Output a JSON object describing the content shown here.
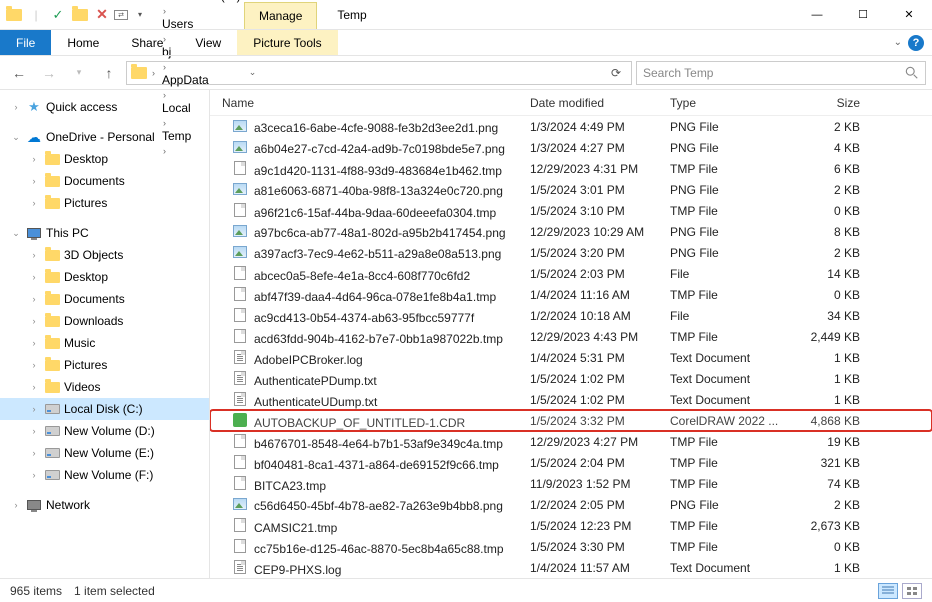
{
  "window": {
    "manage_tab": "Manage",
    "tools_tab": "Picture Tools",
    "title": "Temp",
    "min": "—",
    "max": "☐",
    "close": "✕"
  },
  "ribbon": {
    "file": "File",
    "home": "Home",
    "share": "Share",
    "view": "View"
  },
  "address": {
    "crumbs": [
      "Local Disk (C:)",
      "Users",
      "bj",
      "AppData",
      "Local",
      "Temp"
    ],
    "search_placeholder": "Search Temp"
  },
  "tree": {
    "quick": "Quick access",
    "onedrive": "OneDrive - Personal",
    "od_items": [
      "Desktop",
      "Documents",
      "Pictures"
    ],
    "thispc": "This PC",
    "pc_items": [
      "3D Objects",
      "Desktop",
      "Documents",
      "Downloads",
      "Music",
      "Pictures",
      "Videos",
      "Local Disk (C:)",
      "New Volume (D:)",
      "New Volume (E:)",
      "New Volume (F:)"
    ],
    "network": "Network"
  },
  "columns": {
    "name": "Name",
    "date": "Date modified",
    "type": "Type",
    "size": "Size"
  },
  "files": [
    {
      "name": "a3ceca16-6abe-4cfe-9088-fe3b2d3ee2d1.png",
      "date": "1/3/2024 4:49 PM",
      "type": "PNG File",
      "size": "2 KB",
      "icon": "png"
    },
    {
      "name": "a6b04e27-c7cd-42a4-ad9b-7c0198bde5e7.png",
      "date": "1/3/2024 4:27 PM",
      "type": "PNG File",
      "size": "4 KB",
      "icon": "png"
    },
    {
      "name": "a9c1d420-1131-4f88-93d9-483684e1b462.tmp",
      "date": "12/29/2023 4:31 PM",
      "type": "TMP File",
      "size": "6 KB",
      "icon": "doc"
    },
    {
      "name": "a81e6063-6871-40ba-98f8-13a324e0c720.png",
      "date": "1/5/2024 3:01 PM",
      "type": "PNG File",
      "size": "2 KB",
      "icon": "png"
    },
    {
      "name": "a96f21c6-15af-44ba-9daa-60deeefa0304.tmp",
      "date": "1/5/2024 3:10 PM",
      "type": "TMP File",
      "size": "0 KB",
      "icon": "doc"
    },
    {
      "name": "a97bc6ca-ab77-48a1-802d-a95b2b417454.png",
      "date": "12/29/2023 10:29 AM",
      "type": "PNG File",
      "size": "8 KB",
      "icon": "png"
    },
    {
      "name": "a397acf3-7ec9-4e62-b511-a29a8e08a513.png",
      "date": "1/5/2024 3:20 PM",
      "type": "PNG File",
      "size": "2 KB",
      "icon": "png"
    },
    {
      "name": "abcec0a5-8efe-4e1a-8cc4-608f770c6fd2",
      "date": "1/5/2024 2:03 PM",
      "type": "File",
      "size": "14 KB",
      "icon": "doc"
    },
    {
      "name": "abf47f39-daa4-4d64-96ca-078e1fe8b4a1.tmp",
      "date": "1/4/2024 11:16 AM",
      "type": "TMP File",
      "size": "0 KB",
      "icon": "doc"
    },
    {
      "name": "ac9cd413-0b54-4374-ab63-95fbcc59777f",
      "date": "1/2/2024 10:18 AM",
      "type": "File",
      "size": "34 KB",
      "icon": "doc"
    },
    {
      "name": "acd63fdd-904b-4162-b7e7-0bb1a987022b.tmp",
      "date": "12/29/2023 4:43 PM",
      "type": "TMP File",
      "size": "2,449 KB",
      "icon": "doc"
    },
    {
      "name": "AdobeIPCBroker.log",
      "date": "1/4/2024 5:31 PM",
      "type": "Text Document",
      "size": "1 KB",
      "icon": "txt"
    },
    {
      "name": "AuthenticatePDump.txt",
      "date": "1/5/2024 1:02 PM",
      "type": "Text Document",
      "size": "1 KB",
      "icon": "txt"
    },
    {
      "name": "AuthenticateUDump.txt",
      "date": "1/5/2024 1:02 PM",
      "type": "Text Document",
      "size": "1 KB",
      "icon": "txt"
    },
    {
      "name": "AUTOBACKUP_OF_UNTITLED-1.CDR",
      "date": "1/5/2024 3:32 PM",
      "type": "CorelDRAW 2022 ...",
      "size": "4,868 KB",
      "icon": "cdr",
      "highlight": true
    },
    {
      "name": "b4676701-8548-4e64-b7b1-53af9e349c4a.tmp",
      "date": "12/29/2023 4:27 PM",
      "type": "TMP File",
      "size": "19 KB",
      "icon": "doc"
    },
    {
      "name": "bf040481-8ca1-4371-a864-de69152f9c66.tmp",
      "date": "1/5/2024 2:04 PM",
      "type": "TMP File",
      "size": "321 KB",
      "icon": "doc"
    },
    {
      "name": "BITCA23.tmp",
      "date": "11/9/2023 1:52 PM",
      "type": "TMP File",
      "size": "74 KB",
      "icon": "doc"
    },
    {
      "name": "c56d6450-45bf-4b78-ae82-7a263e9b4bb8.png",
      "date": "1/2/2024 2:05 PM",
      "type": "PNG File",
      "size": "2 KB",
      "icon": "png"
    },
    {
      "name": "CAMSIC21.tmp",
      "date": "1/5/2024 12:23 PM",
      "type": "TMP File",
      "size": "2,673 KB",
      "icon": "doc"
    },
    {
      "name": "cc75b16e-d125-46ac-8870-5ec8b4a65c88.tmp",
      "date": "1/5/2024 3:30 PM",
      "type": "TMP File",
      "size": "0 KB",
      "icon": "doc"
    },
    {
      "name": "CEP9-PHXS.log",
      "date": "1/4/2024 11:57 AM",
      "type": "Text Document",
      "size": "1 KB",
      "icon": "txt"
    }
  ],
  "status": {
    "count": "965 items",
    "selected": "1 item selected"
  }
}
